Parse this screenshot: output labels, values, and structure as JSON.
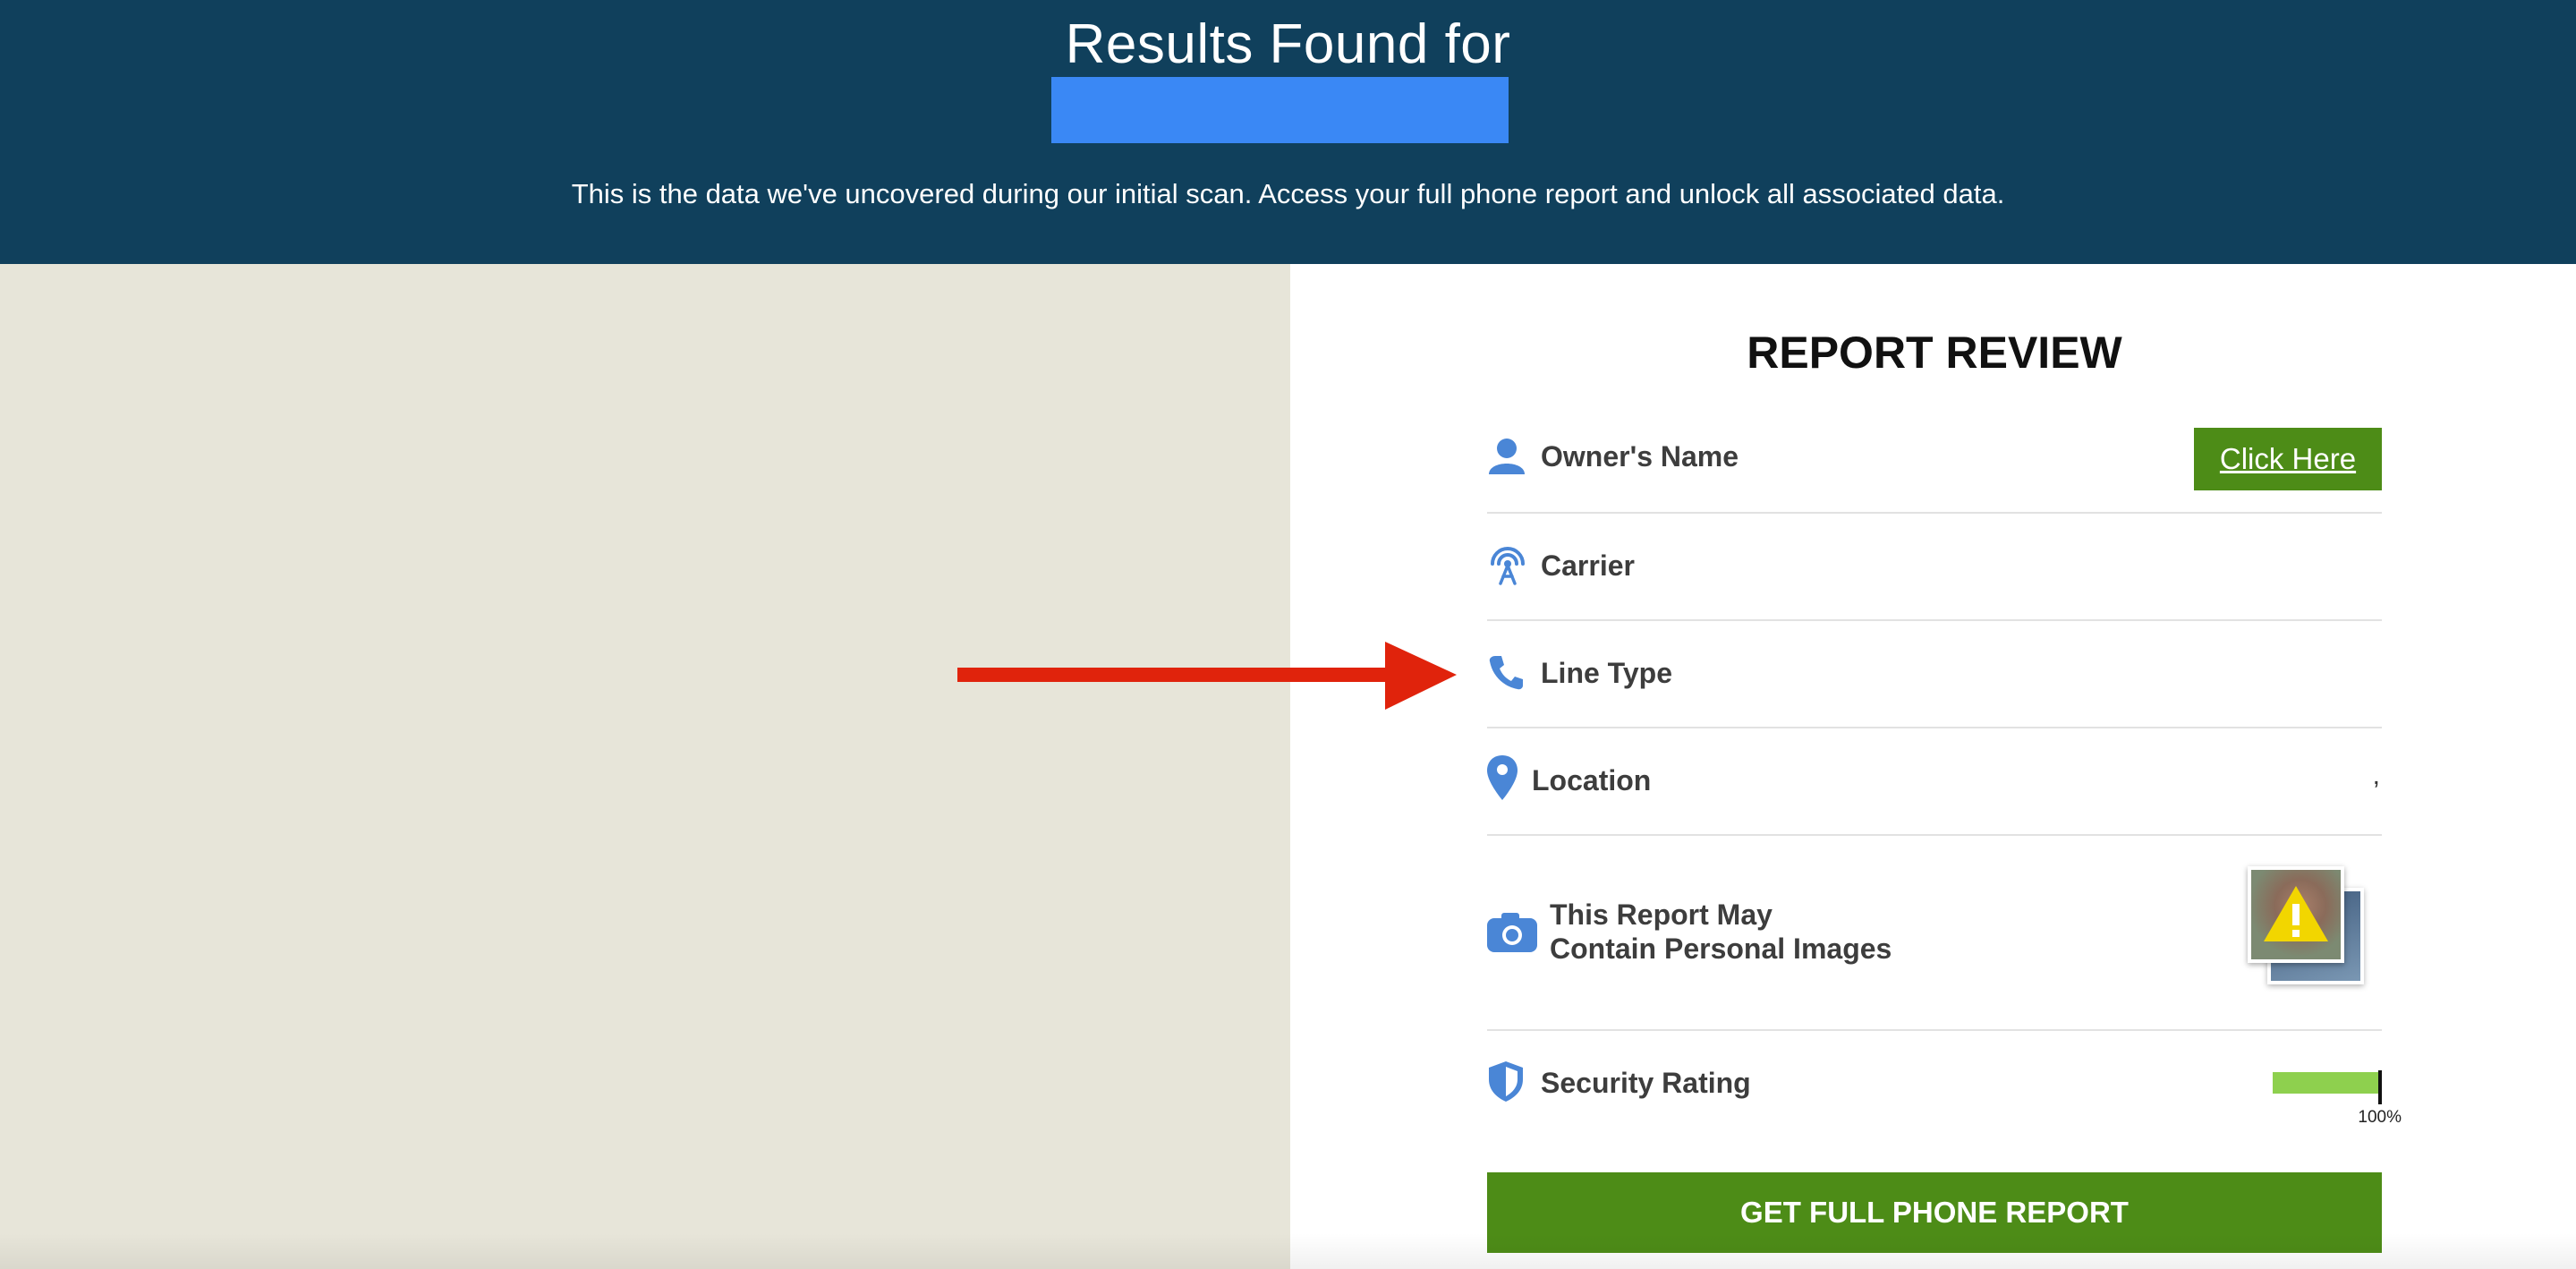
{
  "header": {
    "title": "Results Found for",
    "subtitle": "This is the data we've uncovered during our initial scan. Access your full phone report and unlock all associated data."
  },
  "report": {
    "title": "REPORT REVIEW",
    "rows": [
      {
        "label": "Owner's Name",
        "icon": "person-icon",
        "action": "Click Here"
      },
      {
        "label": "Carrier",
        "icon": "antenna-icon"
      },
      {
        "label": "Line Type",
        "icon": "phone-icon"
      },
      {
        "label": "Location",
        "icon": "location-pin-icon",
        "value": ","
      },
      {
        "label_line1": "This Report May",
        "label_line2": "Contain Personal Images",
        "icon": "camera-icon"
      },
      {
        "label": "Security Rating",
        "icon": "shield-icon",
        "rating_percent": 100,
        "rating_text": "100%"
      }
    ],
    "cta_label": "GET FULL PHONE REPORT"
  },
  "colors": {
    "header_bg": "#10405c",
    "redaction": "#3a88f5",
    "left_panel_bg": "#e7e5d9",
    "accent_green": "#4d8c17",
    "icon_blue": "#4a86d6",
    "arrow_red": "#e0230c",
    "rating_green": "#8ed04e"
  }
}
